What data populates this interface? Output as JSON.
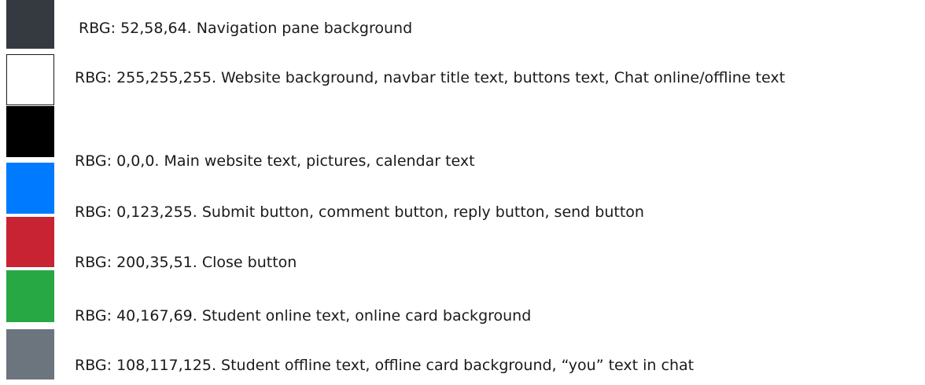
{
  "colors": [
    {
      "swatch": "#343a40",
      "text": "RBG: 52,58,64. Navigation pane background"
    },
    {
      "swatch": "#ffffff",
      "text": "RBG: 255,255,255. Website background, navbar title text, buttons text, Chat online/offline text"
    },
    {
      "swatch": "#000000",
      "text": "RBG: 0,0,0. Main website text, pictures, calendar text"
    },
    {
      "swatch": "#007bff",
      "text": "RBG: 0,123,255. Submit button, comment button, reply button, send button"
    },
    {
      "swatch": "#c82333",
      "text": "RBG: 200,35,51. Close button"
    },
    {
      "swatch": "#28a745",
      "text": "RBG: 40,167,69. Student online text, online card background"
    },
    {
      "swatch": "#6c757d",
      "text": "RBG: 108,117,125. Student offline text, offline card background, “you” text in chat"
    }
  ]
}
